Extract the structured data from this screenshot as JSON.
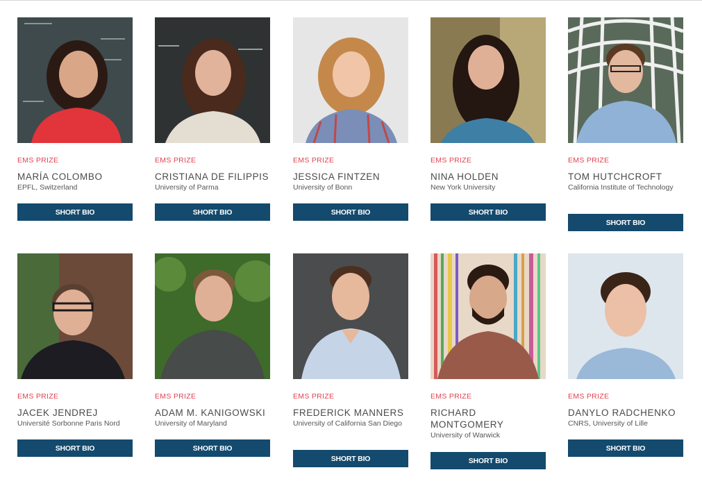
{
  "people": [
    {
      "tag": "EMS PRIZE",
      "name": "MARÍA COLOMBO",
      "affiliation": "EPFL, Switzerland",
      "button": "SHORT BIO"
    },
    {
      "tag": "EMS PRIZE",
      "name": "CRISTIANA DE FILIPPIS",
      "affiliation": "University of Parma",
      "button": "SHORT BIO"
    },
    {
      "tag": "EMS PRIZE",
      "name": "JESSICA FINTZEN",
      "affiliation": "University of Bonn",
      "button": "SHORT BIO"
    },
    {
      "tag": "EMS PRIZE",
      "name": "NINA HOLDEN",
      "affiliation": "New York University",
      "button": "SHORT BIO"
    },
    {
      "tag": "EMS PRIZE",
      "name": "TOM HUTCHCROFT",
      "affiliation": "California Institute of Technology",
      "button": "SHORT BIO"
    },
    {
      "tag": "EMS PRIZE",
      "name": "JACEK JENDREJ",
      "affiliation": "Université Sorbonne Paris Nord",
      "button": "SHORT BIO"
    },
    {
      "tag": "EMS PRIZE",
      "name": "ADAM M. KANIGOWSKI",
      "affiliation": "University of Maryland",
      "button": "SHORT BIO"
    },
    {
      "tag": "EMS PRIZE",
      "name": "FREDERICK MANNERS",
      "affiliation": "University of California San Diego",
      "button": "SHORT BIO"
    },
    {
      "tag": "EMS PRIZE",
      "name": "RICHARD MONTGOMERY",
      "affiliation": "University of Warwick",
      "button": "SHORT BIO"
    },
    {
      "tag": "EMS PRIZE",
      "name": "DANYLO RADCHENKO",
      "affiliation": "CNRS, University of Lille",
      "button": "SHORT BIO"
    }
  ],
  "colors": {
    "tag": "#e0434f",
    "button_bg": "#134a6d",
    "button_text": "#ffffff",
    "name_text": "#4a4a4a"
  }
}
